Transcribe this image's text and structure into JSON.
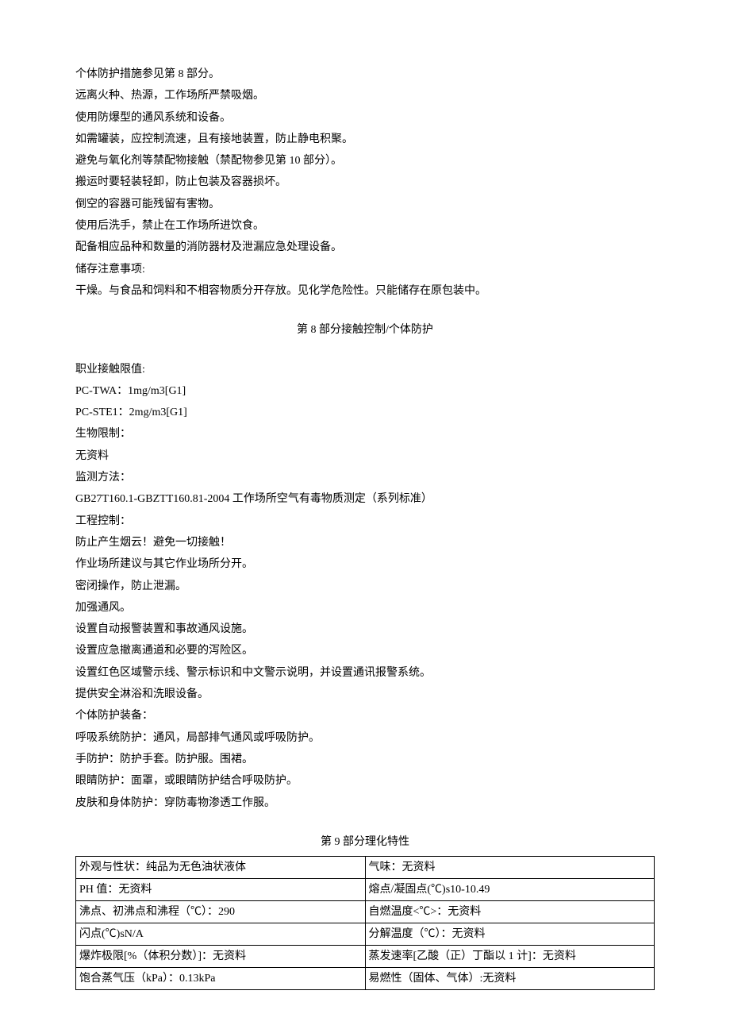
{
  "section7": {
    "lines": [
      "个体防护措施参见第 8 部分。",
      "远离火种、热源，工作场所严禁吸烟。",
      "使用防爆型的通风系统和设备。",
      "如需罐装，应控制流速，且有接地装置，防止静电积聚。",
      "避免与氧化剂等禁配物接触（禁配物参见第 10 部分）。",
      "搬运时要轻装轻卸，防止包装及容器损坏。",
      "倒空的容器可能残留有害物。",
      "使用后洗手，禁止在工作场所进饮食。",
      "配备相应品种和数量的消防器材及泄漏应急处理设备。",
      "储存注意事项:",
      "干燥。与食品和饲料和不相容物质分开存放。见化学危险性。只能储存在原包装中。"
    ]
  },
  "section8": {
    "title": "第 8 部分接触控制/个体防护",
    "lines": [
      "职业接触限值:",
      "PC-TWA：1mg/m3[G1]",
      "PC-STE1：2mg/m3[G1]",
      "生物限制：",
      "无资料",
      "监测方法：",
      "GB27T160.1-GBZTT160.81-2004 工作场所空气有毒物质测定（系列标准）",
      "工程控制：",
      "防止产生烟云！避免一切接触！",
      "作业场所建议与其它作业场所分开。",
      "密闭操作，防止泄漏。",
      "加强通风。",
      "设置自动报警装置和事故通风设施。",
      "设置应急撤离通道和必要的泻险区。",
      "设置红色区域警示线、警示标识和中文警示说明，并设置通讯报警系统。",
      "提供安全淋浴和洗眼设备。",
      "个体防护装备：",
      "呼吸系统防护：通风，局部排气通风或呼吸防护。",
      "手防护：防护手套。防护服。围裙。",
      "眼睛防护：面罩，或眼睛防护结合呼吸防护。",
      "皮肤和身体防护：穿防毒物渗透工作服。"
    ]
  },
  "section9": {
    "title": "第 9 部分理化特性",
    "rows": [
      {
        "left": "外观与性状：纯品为无色油状液体",
        "right": "气味：无资料"
      },
      {
        "left": "PH 值：无资料",
        "right": "熔点/凝固点(℃)s10-10.49"
      },
      {
        "left": "沸点、初沸点和沸程（℃）：290",
        "right": "自燃温度<℃>：无资料"
      },
      {
        "left": "闪点(℃)sN/A",
        "right": "分解温度（℃）：无资料"
      },
      {
        "left": "爆炸极限[%（体积分数）]：无资料",
        "right": "蒸发速率[乙酸（正）丁酯以 1 计]：无资料"
      },
      {
        "left": "饱合蒸气压（kPa）：0.13kPa",
        "right": "易燃性（固体、气体）:无资料"
      }
    ]
  }
}
